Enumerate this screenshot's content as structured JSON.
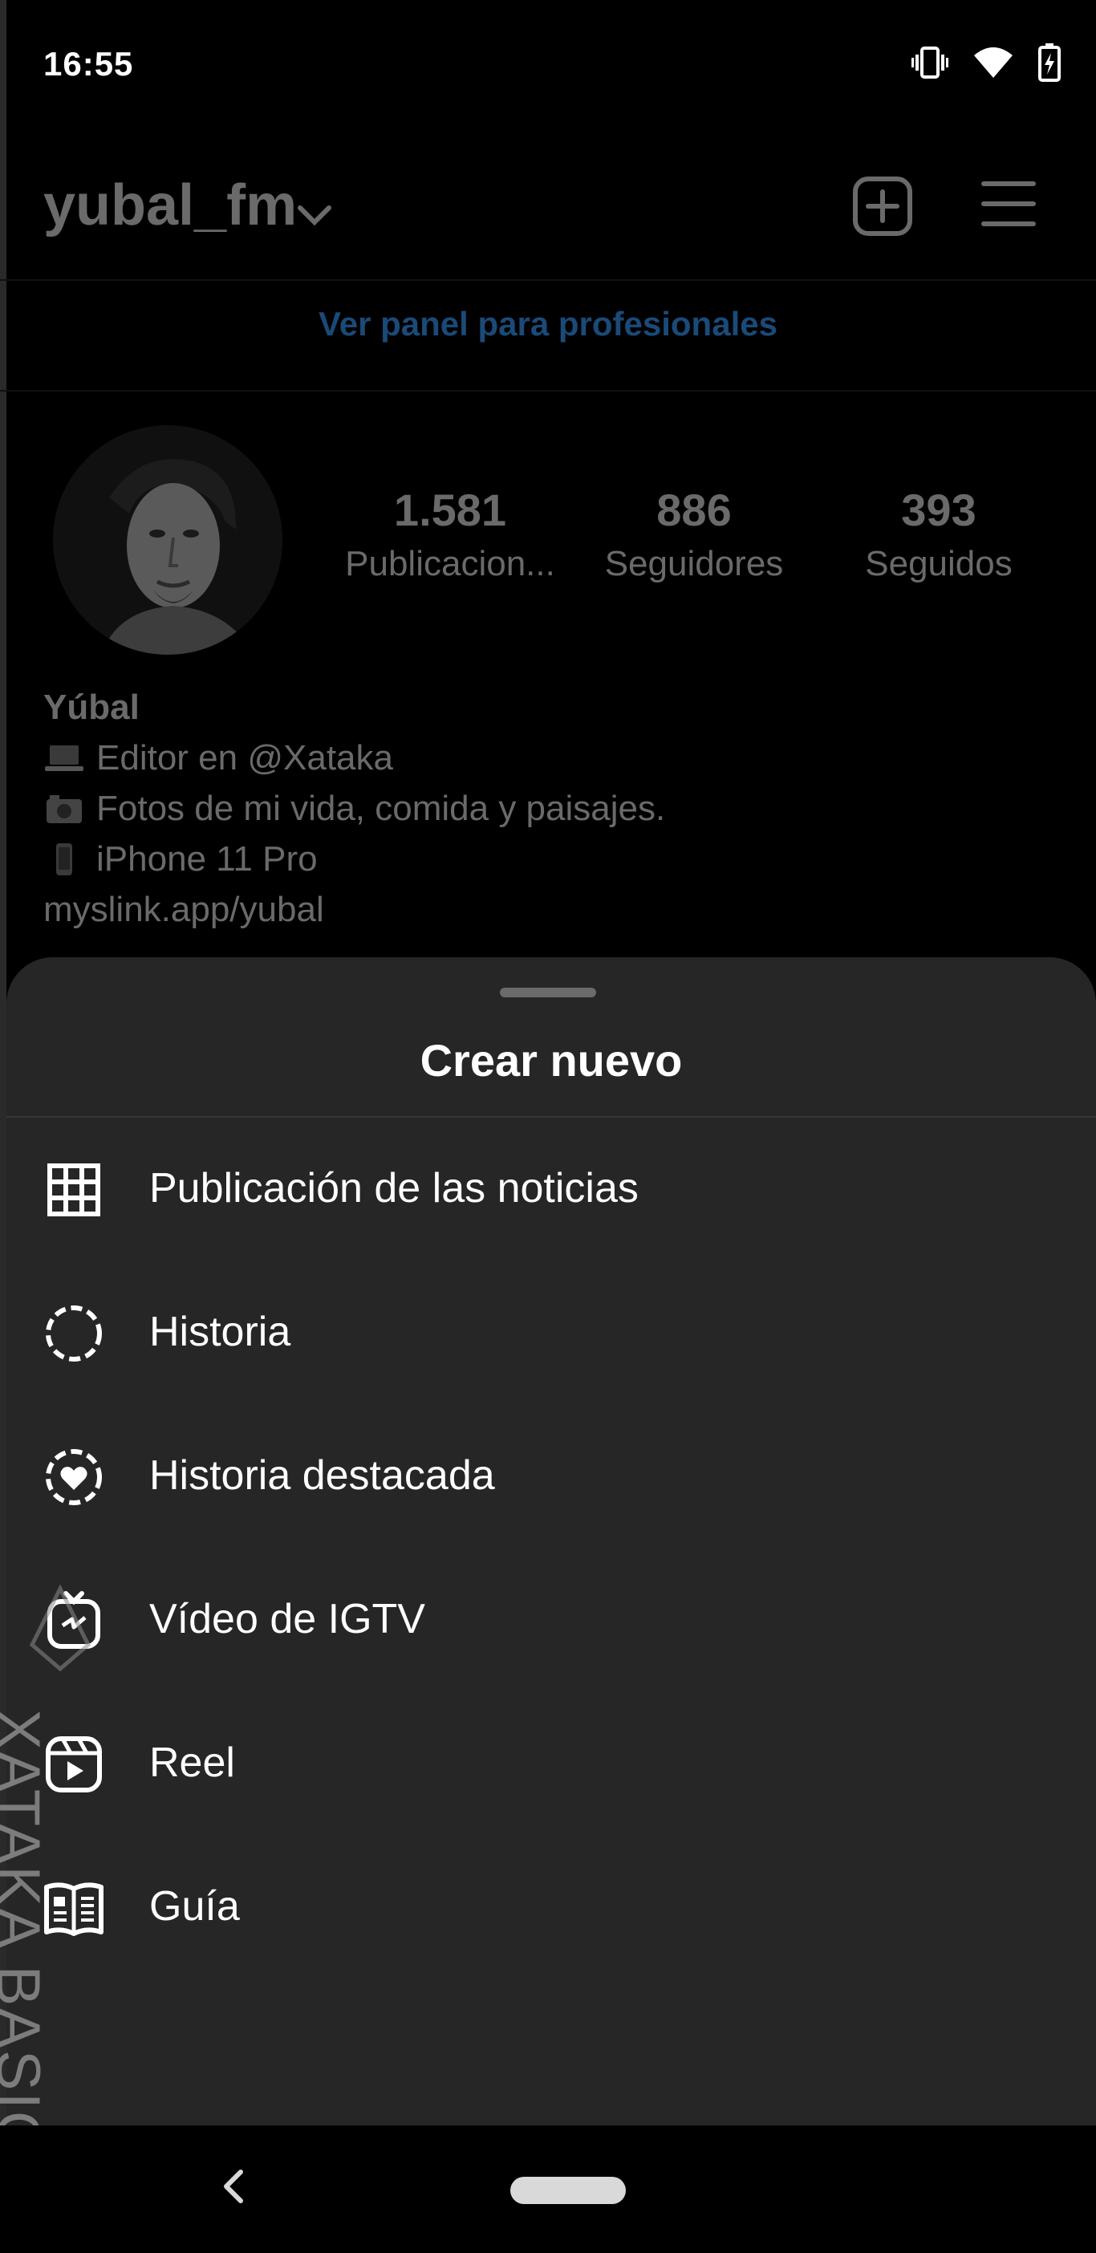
{
  "status_bar": {
    "time": "16:55",
    "icons": [
      "vibrate-icon",
      "wifi-icon",
      "battery-charging-icon"
    ]
  },
  "profile": {
    "username": "yubal_fm",
    "pro_panel_link": "Ver panel para profesionales",
    "stats": [
      {
        "value": "1.581",
        "label": "Publicacion..."
      },
      {
        "value": "886",
        "label": "Seguidores"
      },
      {
        "value": "393",
        "label": "Seguidos"
      }
    ],
    "bio": {
      "name": "Yúbal",
      "lines": [
        {
          "icon": "laptop-emoji",
          "text": "Editor en @Xataka"
        },
        {
          "icon": "camera-emoji",
          "text": "Fotos de mi vida, comida y paisajes."
        },
        {
          "icon": "phone-emoji",
          "text": "iPhone 11 Pro"
        }
      ],
      "link": "myslink.app/yubal"
    }
  },
  "sheet": {
    "title": "Crear nuevo",
    "items": [
      {
        "label": "Publicación de las noticias",
        "icon": "grid-icon"
      },
      {
        "label": "Historia",
        "icon": "story-circle-icon"
      },
      {
        "label": "Historia destacada",
        "icon": "highlight-heart-icon"
      },
      {
        "label": "Vídeo de IGTV",
        "icon": "igtv-icon"
      },
      {
        "label": "Reel",
        "icon": "reel-icon"
      },
      {
        "label": "Guía",
        "icon": "guide-book-icon"
      }
    ]
  },
  "watermark": {
    "text": "XATAKA BASICS"
  },
  "colors": {
    "background": "#000000",
    "sheet": "#262626",
    "dimmed_text": "#6a6a6a",
    "pro_link": "#1a4a78",
    "white": "#ffffff"
  }
}
